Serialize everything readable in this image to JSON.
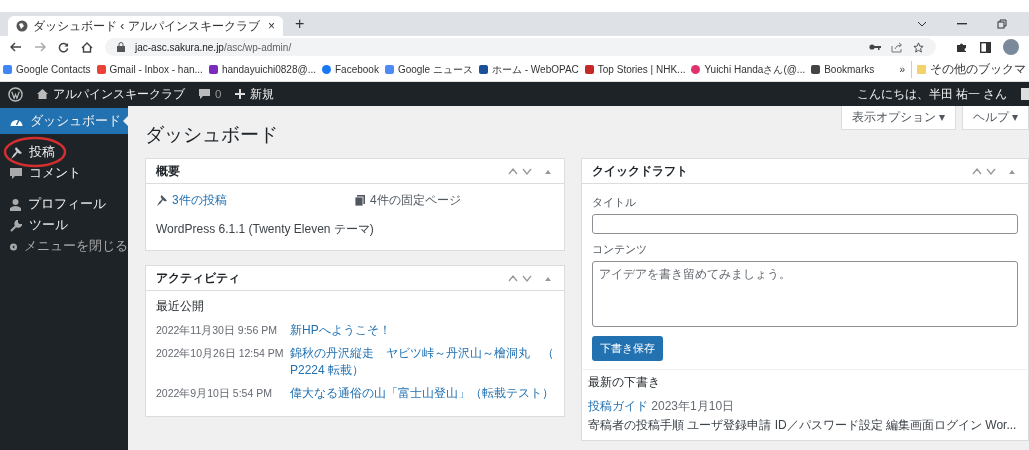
{
  "browser": {
    "tab": {
      "title": "ダッシュボード ‹ アルパインスキークラブ",
      "close": "×"
    },
    "new_tab": "+",
    "url": {
      "host": "jac-asc.sakura.ne.jp",
      "path": "/asc/wp-admin/"
    },
    "bookmarks": [
      {
        "kind": "person",
        "label": "Google Contacts"
      },
      {
        "kind": "gmail",
        "label": "Gmail - Inbox - han..."
      },
      {
        "kind": "mail",
        "label": "handayuichi0828@..."
      },
      {
        "kind": "facebook",
        "label": "Facebook"
      },
      {
        "kind": "news",
        "label": "Google ニュース"
      },
      {
        "kind": "library",
        "label": "ホーム - WebOPAC"
      },
      {
        "kind": "tv",
        "label": "Top Stories | NHK..."
      },
      {
        "kind": "camera",
        "label": "Yuichi Handaさん(@..."
      },
      {
        "kind": "star",
        "label": "Bookmarks"
      }
    ],
    "more_bookmarks": "»",
    "other_bookmarks": "その他のブックマ"
  },
  "admin_bar": {
    "site": "アルパインスキークラブ",
    "comments": "0",
    "new": "新規",
    "greeting": "こんにちは、半田 祐一 さん"
  },
  "sidebar": {
    "items": [
      {
        "kind": "dashboard",
        "label": "ダッシュボード",
        "selected": true,
        "circled": false
      },
      {
        "kind": "pin",
        "label": "投稿",
        "selected": false,
        "circled": true
      },
      {
        "kind": "comment",
        "label": "コメント",
        "selected": false,
        "circled": false
      },
      {
        "kind": "user",
        "label": "プロフィール",
        "selected": false,
        "circled": false
      },
      {
        "kind": "wrench",
        "label": "ツール",
        "selected": false,
        "circled": false
      },
      {
        "kind": "collapse",
        "label": "メニューを閉じる",
        "selected": false,
        "circled": false
      }
    ]
  },
  "page": {
    "title": "ダッシュボード",
    "screen_options": "表示オプション ▾",
    "help": "ヘルプ ▾"
  },
  "overview": {
    "title": "概要",
    "posts": "3件の投稿",
    "pages": "4件の固定ページ",
    "version": "WordPress 6.1.1 (Twenty Eleven テーマ)"
  },
  "activity": {
    "title": "アクティビティ",
    "heading": "最近公開",
    "items": [
      {
        "date": "2022年11月30日 9:56 PM",
        "title": "新HPへようこそ！"
      },
      {
        "date": "2022年10月26日 12:54 PM",
        "title": "錦秋の丹沢縦走　ヤビツ峠～丹沢山～檜洞丸　（P2224 転載）"
      },
      {
        "date": "2022年9月10日 5:54 PM",
        "title": "偉大なる通俗の山「富士山登山」（転載テスト）"
      }
    ]
  },
  "quick_draft": {
    "title": "クイックドラフト",
    "title_label": "タイトル",
    "content_label": "コンテンツ",
    "content_placeholder": "アイデアを書き留めてみましょう。",
    "save": "下書き保存",
    "drafts_heading": "最新の下書き",
    "draft": {
      "title": "投稿ガイド",
      "date": "2023年1月10日",
      "excerpt": "寄稿者の投稿手順 ユーザ登録申請 ID／パスワード設定 編集画面ログイン Wor..."
    }
  }
}
